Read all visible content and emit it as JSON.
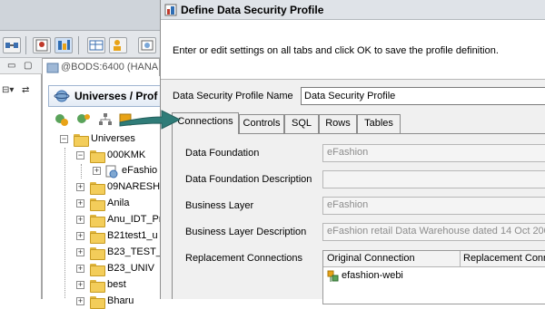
{
  "background_app": {
    "session_tab_label": "@BODS:6400 (HANA",
    "universes_panel_title": "Universes / Prof",
    "tree": [
      {
        "label": "Universes",
        "expander": "−"
      },
      {
        "label": "000KMK",
        "expander": "−"
      },
      {
        "label": "eFashio",
        "expander": "+"
      },
      {
        "label": "09NARESH",
        "expander": "+"
      },
      {
        "label": "Anila",
        "expander": "+"
      },
      {
        "label": "Anu_IDT_Pr",
        "expander": "+"
      },
      {
        "label": "B21test1_u",
        "expander": "+"
      },
      {
        "label": "B23_TEST_I",
        "expander": "+"
      },
      {
        "label": "B23_UNIV",
        "expander": "+"
      },
      {
        "label": "best",
        "expander": "+"
      },
      {
        "label": "Bharu",
        "expander": "+"
      }
    ]
  },
  "dialog": {
    "title": "Define Data Security Profile",
    "message": "Enter or edit settings on all tabs and click OK to save the profile definition.",
    "name_label": "Data Security Profile Name",
    "name_value": "Data Security Profile",
    "tabs": [
      {
        "label": "Connections",
        "active": true
      },
      {
        "label": "Controls",
        "active": false
      },
      {
        "label": "SQL",
        "active": false
      },
      {
        "label": "Rows",
        "active": false
      },
      {
        "label": "Tables",
        "active": false
      }
    ],
    "fields": {
      "data_foundation_label": "Data Foundation",
      "data_foundation_value": "eFashion",
      "data_foundation_desc_label": "Data Foundation Description",
      "data_foundation_desc_value": "",
      "business_layer_label": "Business Layer",
      "business_layer_value": "eFashion",
      "business_layer_desc_label": "Business Layer Description",
      "business_layer_desc_value": "eFashion retail Data Warehouse dated 14 Oct 200",
      "replacement_label": "Replacement Connections"
    },
    "connections_table": {
      "columns": [
        "Original Connection",
        "Replacement Conne"
      ],
      "rows": [
        [
          "efashion-webi",
          ""
        ]
      ]
    }
  },
  "colors": {
    "accent_arrow": "#2f7c78",
    "folder": "#f3cd5a",
    "dialog_body": "#f0f0f0"
  }
}
